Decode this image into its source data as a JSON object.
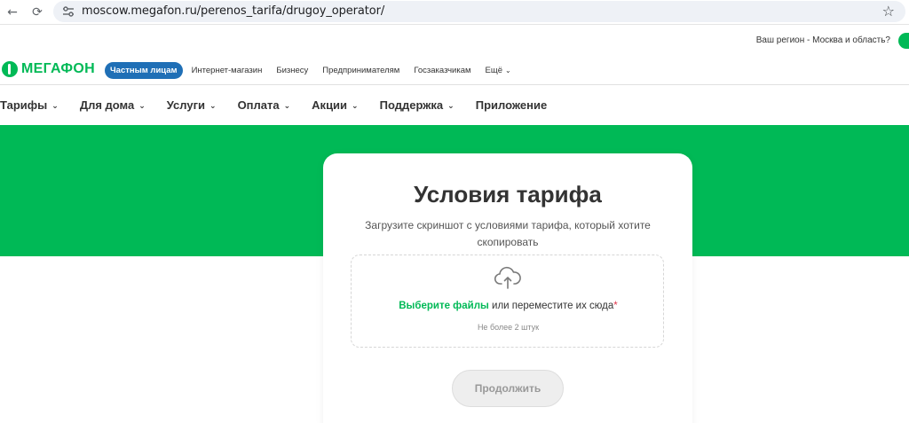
{
  "browser": {
    "back_icon": "←",
    "reload_icon": "⟳",
    "url": "moscow.megafon.ru/perenos_tarifa/drugoy_operator/",
    "star_icon": "☆"
  },
  "region": {
    "question": "Ваш регион - Москва и область?"
  },
  "header": {
    "logo_text": "МЕГАФОН",
    "segments": [
      {
        "label": "Частным лицам"
      },
      {
        "label": "Интернет-магазин"
      },
      {
        "label": "Бизнесу"
      },
      {
        "label": "Предпринимателям"
      },
      {
        "label": "Госзаказчикам"
      },
      {
        "label": "Ещё"
      }
    ]
  },
  "main_nav": {
    "items": [
      {
        "label": "Тарифы"
      },
      {
        "label": "Для дома"
      },
      {
        "label": "Услуги"
      },
      {
        "label": "Оплата"
      },
      {
        "label": "Акции"
      },
      {
        "label": "Поддержка"
      },
      {
        "label": "Приложение"
      }
    ]
  },
  "card": {
    "title": "Условия тарифа",
    "subtitle": "Загрузите скриншот с условиями тарифа, который хотите скопировать",
    "choose_files": "Выберите файлы",
    "drop_text": " или переместите их сюда",
    "required_mark": "*",
    "hint": "Не более 2 штук",
    "continue_label": "Продолжить"
  },
  "colors": {
    "brand_green": "#00b956",
    "active_segment": "#1f6fb6",
    "required": "#e0364b"
  }
}
